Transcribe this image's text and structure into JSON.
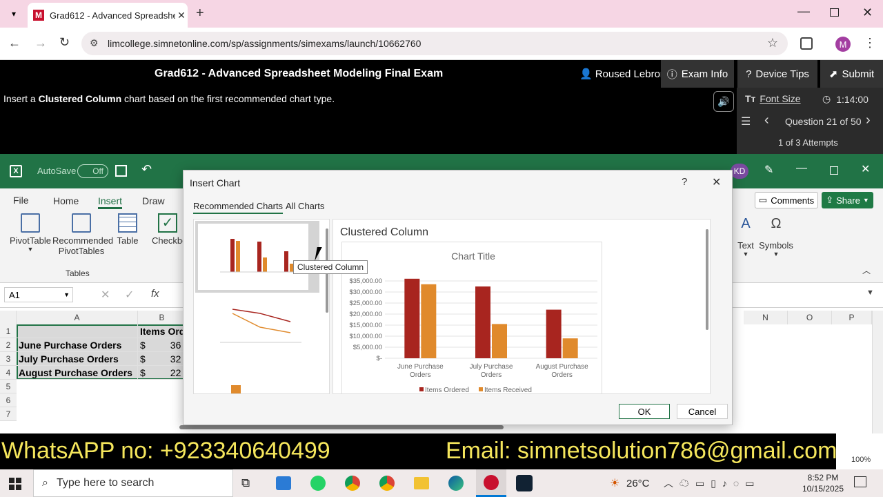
{
  "browser": {
    "tab_title": "Grad612 - Advanced Spreadshe",
    "url": "limcollege.simnetonline.com/sp/assignments/simexams/launch/10662760",
    "profile_initial": "M"
  },
  "exam": {
    "title": "Grad612 - Advanced Spreadsheet Modeling Final Exam",
    "user": "Roused Lebron",
    "exam_info": "Exam Info",
    "device_tips": "Device Tips",
    "submit": "Submit",
    "instruction_pre": "Insert a ",
    "instruction_bold": "Clustered Column",
    "instruction_post": " chart based on the first recommended chart type.",
    "font_size": "Font Size",
    "timer": "1:14:00",
    "question": "Question 21 of 50",
    "attempts": "1 of 3 Attempts"
  },
  "excel": {
    "autosave": "AutoSave",
    "autosave_state": "Off",
    "user_initials": "KD",
    "tabs": [
      "File",
      "Home",
      "Insert",
      "Draw"
    ],
    "ribbon": {
      "pivottable": "PivotTable",
      "recommended_pivot_1": "Recommended",
      "recommended_pivot_2": "PivotTables",
      "table": "Table",
      "checkbox": "Checkbo",
      "group_tables": "Tables",
      "comments": "Comments",
      "share": "Share",
      "text": "Text",
      "symbols": "Symbols"
    },
    "namebox": "A1",
    "columns_left": [
      "A",
      "B"
    ],
    "columns_right": [
      "N",
      "O",
      "P"
    ],
    "rows": [
      "1",
      "2",
      "3",
      "4",
      "5",
      "6",
      "7"
    ],
    "cells": {
      "b1": "Items Ord",
      "a2": "June Purchase Orders",
      "b2_sym": "$",
      "b2": "36",
      "a3": "July Purchase Orders",
      "b3_sym": "$",
      "b3": "32",
      "a4": "August Purchase Orders",
      "b4_sym": "$",
      "b4": "22"
    },
    "zoom": "100%"
  },
  "dialog": {
    "title": "Insert Chart",
    "help": "?",
    "tab_recommended": "Recommended Charts",
    "tab_all": "All Charts",
    "preview_title": "Clustered Column",
    "tooltip": "Clustered Column",
    "ok": "OK",
    "cancel": "Cancel"
  },
  "chart_data": {
    "type": "bar",
    "title": "Chart Title",
    "categories": [
      "June Purchase Orders",
      "July Purchase Orders",
      "August Purchase Orders"
    ],
    "series": [
      {
        "name": "Items Ordered",
        "values": [
          36000,
          32500,
          22000
        ],
        "color": "#a8251f"
      },
      {
        "name": "Items Received",
        "values": [
          33500,
          15500,
          9000
        ],
        "color": "#e08a2c"
      }
    ],
    "yticks": [
      "$-",
      "$5,000.00",
      "$10,000.00",
      "$15,000.00",
      "$20,000.00",
      "$25,000.00",
      "$30,000.00",
      "$35,000.00"
    ],
    "ylim": [
      0,
      40000
    ],
    "grid": true,
    "legend": "bottom"
  },
  "banner": {
    "left": "WhatsAPP no: +923340640499",
    "right": "Email: simnetsolution786@gmail.com"
  },
  "taskbar": {
    "search_placeholder": "Type here to search",
    "temp": "26°C",
    "time": "8:52 PM",
    "date": "10/15/2025"
  }
}
